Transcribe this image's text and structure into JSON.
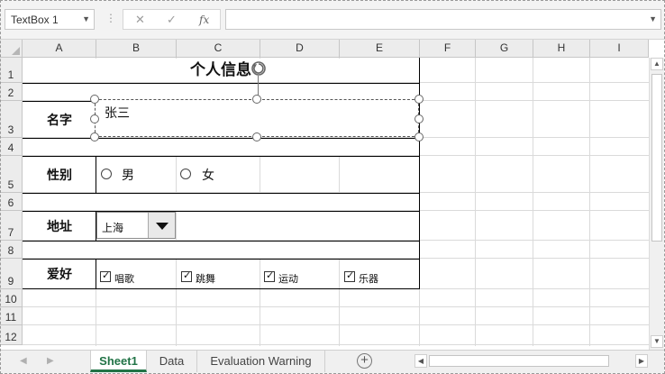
{
  "formula_bar": {
    "name_box": "TextBox 1",
    "cancel_glyph": "✕",
    "enter_glyph": "✓",
    "fx_label": "fx",
    "formula": ""
  },
  "columns": [
    "A",
    "B",
    "C",
    "D",
    "E",
    "F",
    "G",
    "H",
    "I"
  ],
  "rows": [
    "1",
    "2",
    "3",
    "4",
    "5",
    "6",
    "7",
    "8",
    "9",
    "10",
    "11",
    "12"
  ],
  "form": {
    "title": "个人信息",
    "name_label": "名字",
    "name_value": "张三",
    "gender_label": "性别",
    "gender_options": [
      "男",
      "女"
    ],
    "address_label": "地址",
    "address_value": "上海",
    "hobby_label": "爱好",
    "hobbies": [
      "唱歌",
      "跳舞",
      "运动",
      "乐器"
    ]
  },
  "tabs": [
    "Sheet1",
    "Data",
    "Evaluation Warning"
  ],
  "active_tab": "Sheet1",
  "accent_color": "#217346"
}
